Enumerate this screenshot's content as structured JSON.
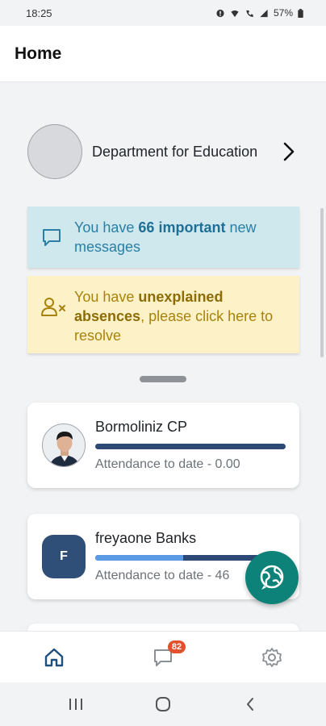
{
  "status_bar": {
    "time": "18:25",
    "battery": "57%"
  },
  "header": {
    "title": "Home"
  },
  "organisation": {
    "name": "Department for Education"
  },
  "banners": {
    "messages": {
      "prefix": "You have ",
      "highlight": "66 important",
      "suffix": " new messages",
      "icon": "message-icon",
      "color": "#2a7fa4",
      "background": "#cfe8ee"
    },
    "absences": {
      "prefix": "You have ",
      "highlight": "unexplained absences",
      "suffix": ", please click here to resolve",
      "icon": "user-x-icon",
      "color": "#a7830c",
      "background": "#fdf1c8"
    }
  },
  "students": [
    {
      "name": "Bormoliniz CP",
      "attendance": "Attendance to date - 0.00",
      "progress": 0
    },
    {
      "name": "freyaone Banks",
      "initial": "F",
      "attendance": "Attendance to date - 46",
      "progress": 0.46
    }
  ],
  "fab": {
    "icon": "globe-chat-icon",
    "color": "#0c8278"
  },
  "bottom_nav": {
    "items": [
      {
        "name": "home",
        "icon": "home-icon"
      },
      {
        "name": "messages",
        "icon": "chat-icon",
        "badge": "82"
      },
      {
        "name": "settings",
        "icon": "gear-icon"
      }
    ]
  },
  "system_nav": {
    "items": [
      "recents-icon",
      "home-circle-icon",
      "back-icon"
    ]
  }
}
